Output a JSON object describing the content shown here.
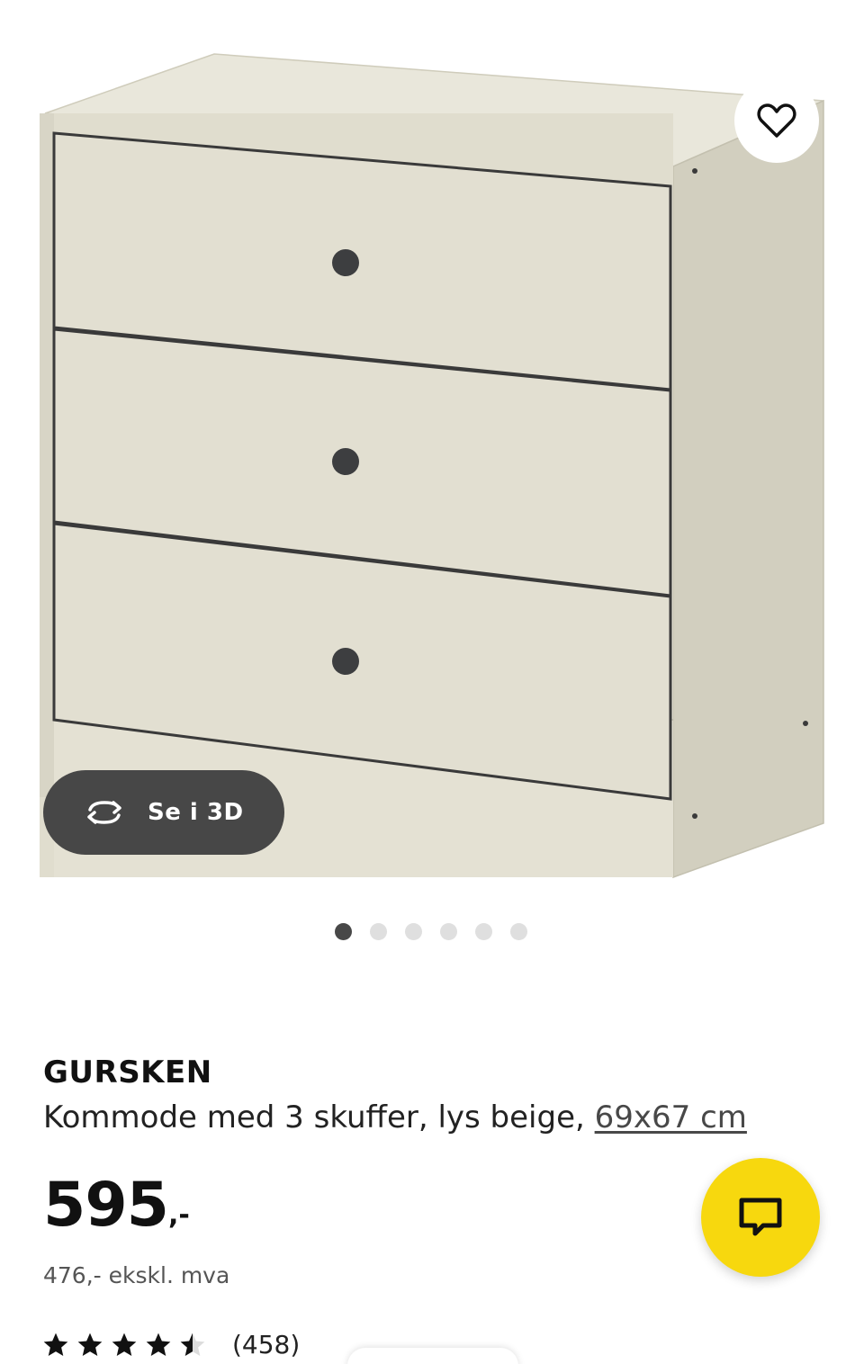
{
  "gallery": {
    "view_3d_label": "Se i 3D",
    "image_count": 6,
    "active_index": 0
  },
  "product": {
    "name": "GURSKEN",
    "description": "Kommode med 3 skuffer, lys beige, ",
    "size_link": "69x67 cm",
    "price_main": "595",
    "price_suffix": ",-",
    "price_excl_vat": "476,- ekskl. mva",
    "rating": 4.5,
    "rating_max": 5,
    "rating_count": "(458)"
  },
  "icons": {
    "favourite": "heart-outline-icon",
    "view_3d": "rotate-arrows-icon",
    "chat": "chat-bubble-icon"
  },
  "colors": {
    "accent_yellow": "#f7d80e",
    "button_dark": "#474747",
    "dresser_beige": "#dedacb"
  }
}
